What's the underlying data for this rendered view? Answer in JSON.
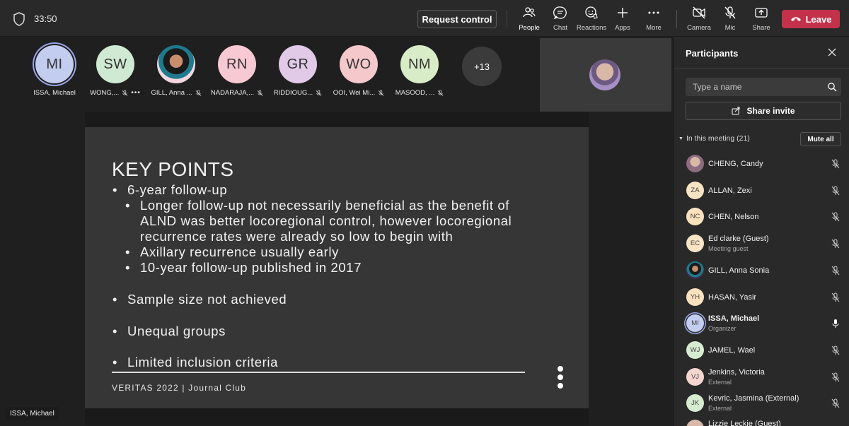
{
  "topbar": {
    "timer": "33:50",
    "request_control": "Request control",
    "buttons": [
      {
        "label": "People",
        "icon": "people-icon"
      },
      {
        "label": "Chat",
        "icon": "chat-icon"
      },
      {
        "label": "Reactions",
        "icon": "reactions-icon"
      },
      {
        "label": "Apps",
        "icon": "apps-icon"
      },
      {
        "label": "More",
        "icon": "more-icon"
      },
      {
        "label": "Camera",
        "icon": "camera-off-icon"
      },
      {
        "label": "Mic",
        "icon": "mic-off-icon"
      },
      {
        "label": "Share",
        "icon": "share-icon"
      }
    ],
    "leave": "Leave",
    "leave_color": "#c4314b"
  },
  "strip": {
    "tiles": [
      {
        "initials": "MI",
        "name": "ISSA, Michael",
        "color": "#c3cdef"
      },
      {
        "initials": "SW",
        "name": "WONG,...",
        "color": "#cfe9d3"
      },
      {
        "initials": "",
        "name": "GILL, Anna ...",
        "color": "#f2d7e0"
      },
      {
        "initials": "RN",
        "name": "NADARAJA,...",
        "color": "#f7c9d3"
      },
      {
        "initials": "GR",
        "name": "RIDDIOUG...",
        "color": "#e1c9e8"
      },
      {
        "initials": "WO",
        "name": "OOI, Wei Mi...",
        "color": "#f5c8cc"
      },
      {
        "initials": "NM",
        "name": "MASOOD, ...",
        "color": "#d9ecc8"
      }
    ],
    "overflow": "+13"
  },
  "slide": {
    "title": "KEY POINTS",
    "b1": "6-year follow-up",
    "b1a_line1": "Longer follow-up not necessarily beneficial as the benefit of",
    "b1a_line2": "ALND was better locoregional control, however locoregional",
    "b1a_line3": "recurrence rates were already so low to begin with",
    "b1b": "Axillary recurrence usually early",
    "b1c": "10-year follow-up published in 2017",
    "b2": "Sample size not achieved",
    "b3": "Unequal groups",
    "b4": "Limited inclusion criteria",
    "footer": "VERITAS 2022 | Journal Club"
  },
  "presenter_tag": "ISSA, Michael",
  "panel": {
    "title": "Participants",
    "search_placeholder": "Type a name",
    "share_invite": "Share invite",
    "in_meeting": "In this meeting (21)",
    "mute_all": "Mute all",
    "participants": [
      {
        "initials": "",
        "name": "CHENG, Candy",
        "sub": "",
        "color": "#c9a8b0",
        "mic": "off"
      },
      {
        "initials": "ZA",
        "name": "ALLAN, Zexi",
        "sub": "",
        "color": "#f8e3c2",
        "mic": "off"
      },
      {
        "initials": "NC",
        "name": "CHEN, Nelson",
        "sub": "",
        "color": "#fbe2bf",
        "mic": "off"
      },
      {
        "initials": "EC",
        "name": "Ed clarke (Guest)",
        "sub": "Meeting guest",
        "color": "#f7e5c5",
        "mic": "off"
      },
      {
        "initials": "",
        "name": "GILL, Anna Sonia",
        "sub": "",
        "color": "#3a2a4a",
        "mic": "off"
      },
      {
        "initials": "YH",
        "name": "HASAN, Yasir",
        "sub": "",
        "color": "#fbe2bf",
        "mic": "off"
      },
      {
        "initials": "MI",
        "name": "ISSA, Michael",
        "sub": "Organizer",
        "color": "#c3cdef",
        "mic": "on"
      },
      {
        "initials": "WJ",
        "name": "JAMEL, Wael",
        "sub": "",
        "color": "#d6ecd0",
        "mic": "off"
      },
      {
        "initials": "VJ",
        "name": "Jenkins, Victoria",
        "sub": "External",
        "color": "#f4d6cf",
        "mic": "off"
      },
      {
        "initials": "JK",
        "name": "Kevric, Jasmina (External)",
        "sub": "External",
        "color": "#d6ecd0",
        "mic": "off"
      },
      {
        "initials": "",
        "name": "Lizzie Leckie (Guest)",
        "sub": "",
        "color": "#f0d8c8",
        "mic": "off"
      }
    ]
  }
}
